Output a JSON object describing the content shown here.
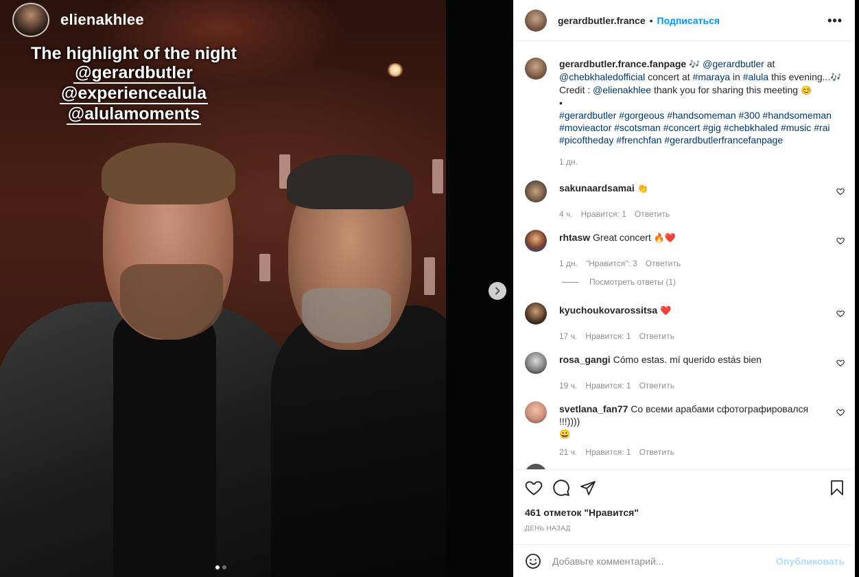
{
  "story": {
    "username": "elienakhlee",
    "lines": [
      "The highlight of the night",
      "@gerardbutler",
      "@experiencealula",
      "@alulamoments"
    ]
  },
  "header": {
    "username": "gerardbutler.france",
    "separator": "•",
    "follow_label": "Подписаться",
    "more_label": "•••"
  },
  "caption": {
    "username": "gerardbutler.france.fanpage",
    "mention1": "@gerardbutler",
    "text_at": " at",
    "mention2": "@chebkhaledofficial",
    "text_concert_at": " concert at ",
    "tag_maraya": "#maraya",
    "text_in": " in ",
    "tag_alula": "#alula",
    "text_evening": " this evening...",
    "credit_label": "Credit : ",
    "credit_user": "@elienakhlee",
    "credit_text": " thank you for sharing this meeting ",
    "bullet": "•",
    "hashtags": "#gerardbutler #gorgeous #handsomeman #300 #handsomeman #movieactor #scotsman #concert #gig #chebkhaled #music #rai #picoftheday #frenchfan #gerardbutlerfrancefanpage",
    "time": "1 дн."
  },
  "comments": [
    {
      "username": "sakunaardsamai",
      "text": "",
      "emoji": "👏",
      "time": "4 ч.",
      "likes": "Нравится: 1",
      "reply": "Ответить"
    },
    {
      "username": "rhtasw",
      "text": "Great concert",
      "emoji": "🔥❤️",
      "time": "1 дн.",
      "likes": "\"Нравится\": 3",
      "reply": "Ответить"
    },
    {
      "username": "kyuchoukovarossitsa",
      "text": "",
      "emoji": "❤️",
      "time": "17 ч.",
      "likes": "Нравится: 1",
      "reply": "Ответить"
    },
    {
      "username": "rosa_gangi",
      "text": "Cómo estas. mí querido estás bien",
      "emoji": "",
      "time": "19 ч.",
      "likes": "Нравится: 1",
      "reply": "Ответить"
    },
    {
      "username": "svetlana_fan77",
      "text": "Со всеми арабами сфотографировался !!!))))",
      "emoji": "😀",
      "time": "21 ч.",
      "likes": "Нравится: 1",
      "reply": "Ответить"
    }
  ],
  "view_replies": "Посмотреть ответы (1)",
  "likes_count": "461 отметок \"Нравится\"",
  "post_date": "ДЕНЬ НАЗАД",
  "add_comment": {
    "placeholder": "Добавьте комментарий...",
    "publish_label": "Опубликовать"
  },
  "colors": {
    "link": "#00376b",
    "follow": "#0095f6",
    "muted": "#8e8e8e",
    "publish_disabled": "#b3dbff"
  }
}
